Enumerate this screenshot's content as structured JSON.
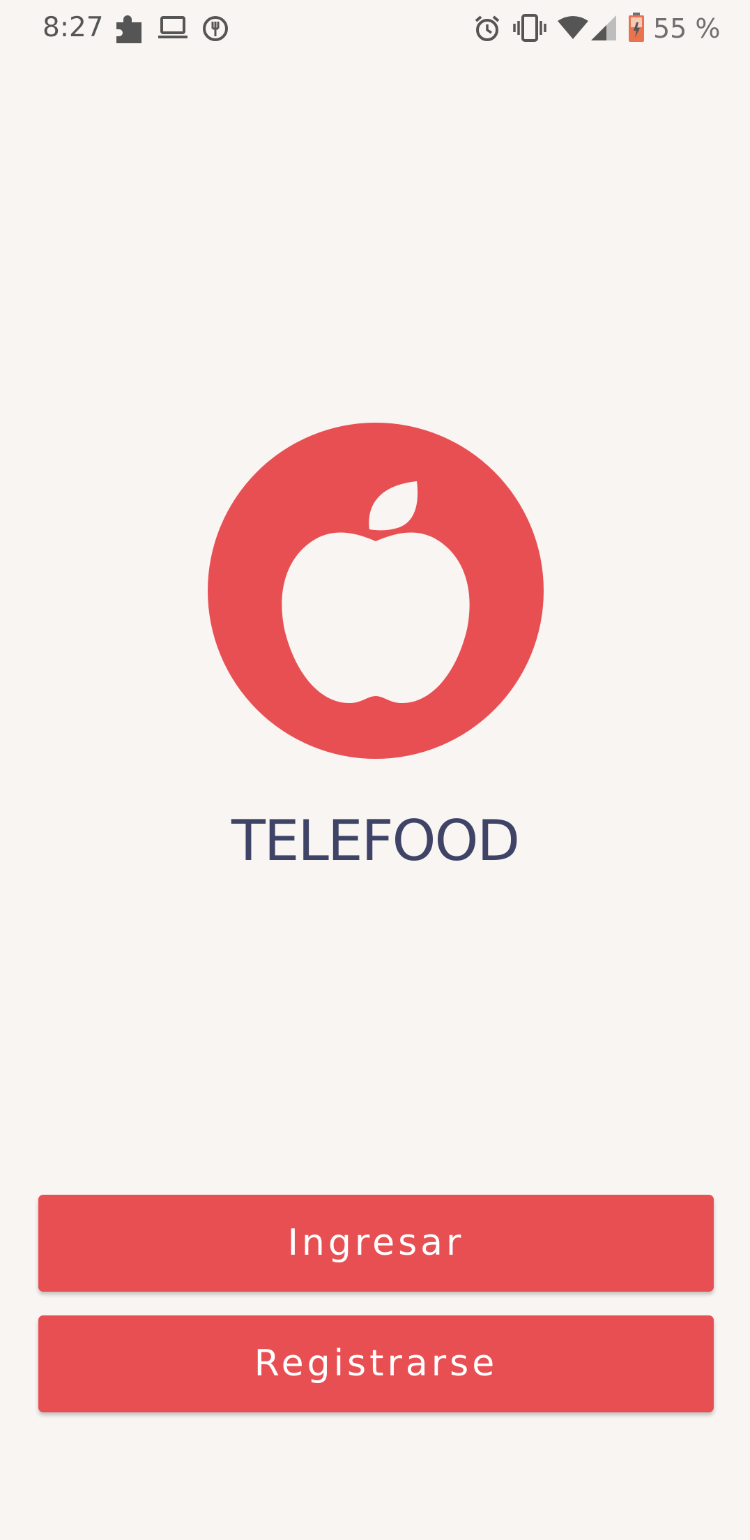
{
  "status_bar": {
    "time": "8:27",
    "battery_text": "55 %",
    "icons": [
      "puzzle-icon",
      "laptop-icon",
      "food-notification-icon",
      "alarm-icon",
      "vibrate-icon",
      "wifi-icon",
      "signal-icon",
      "battery-icon"
    ]
  },
  "app": {
    "name": "TELEFOOD",
    "logo": "apple-icon",
    "brand_color": "#e84f53",
    "title_color": "#3f4466",
    "background_color": "#f9f5f3"
  },
  "actions": {
    "login_label": "Ingresar",
    "register_label": "Registrarse"
  }
}
